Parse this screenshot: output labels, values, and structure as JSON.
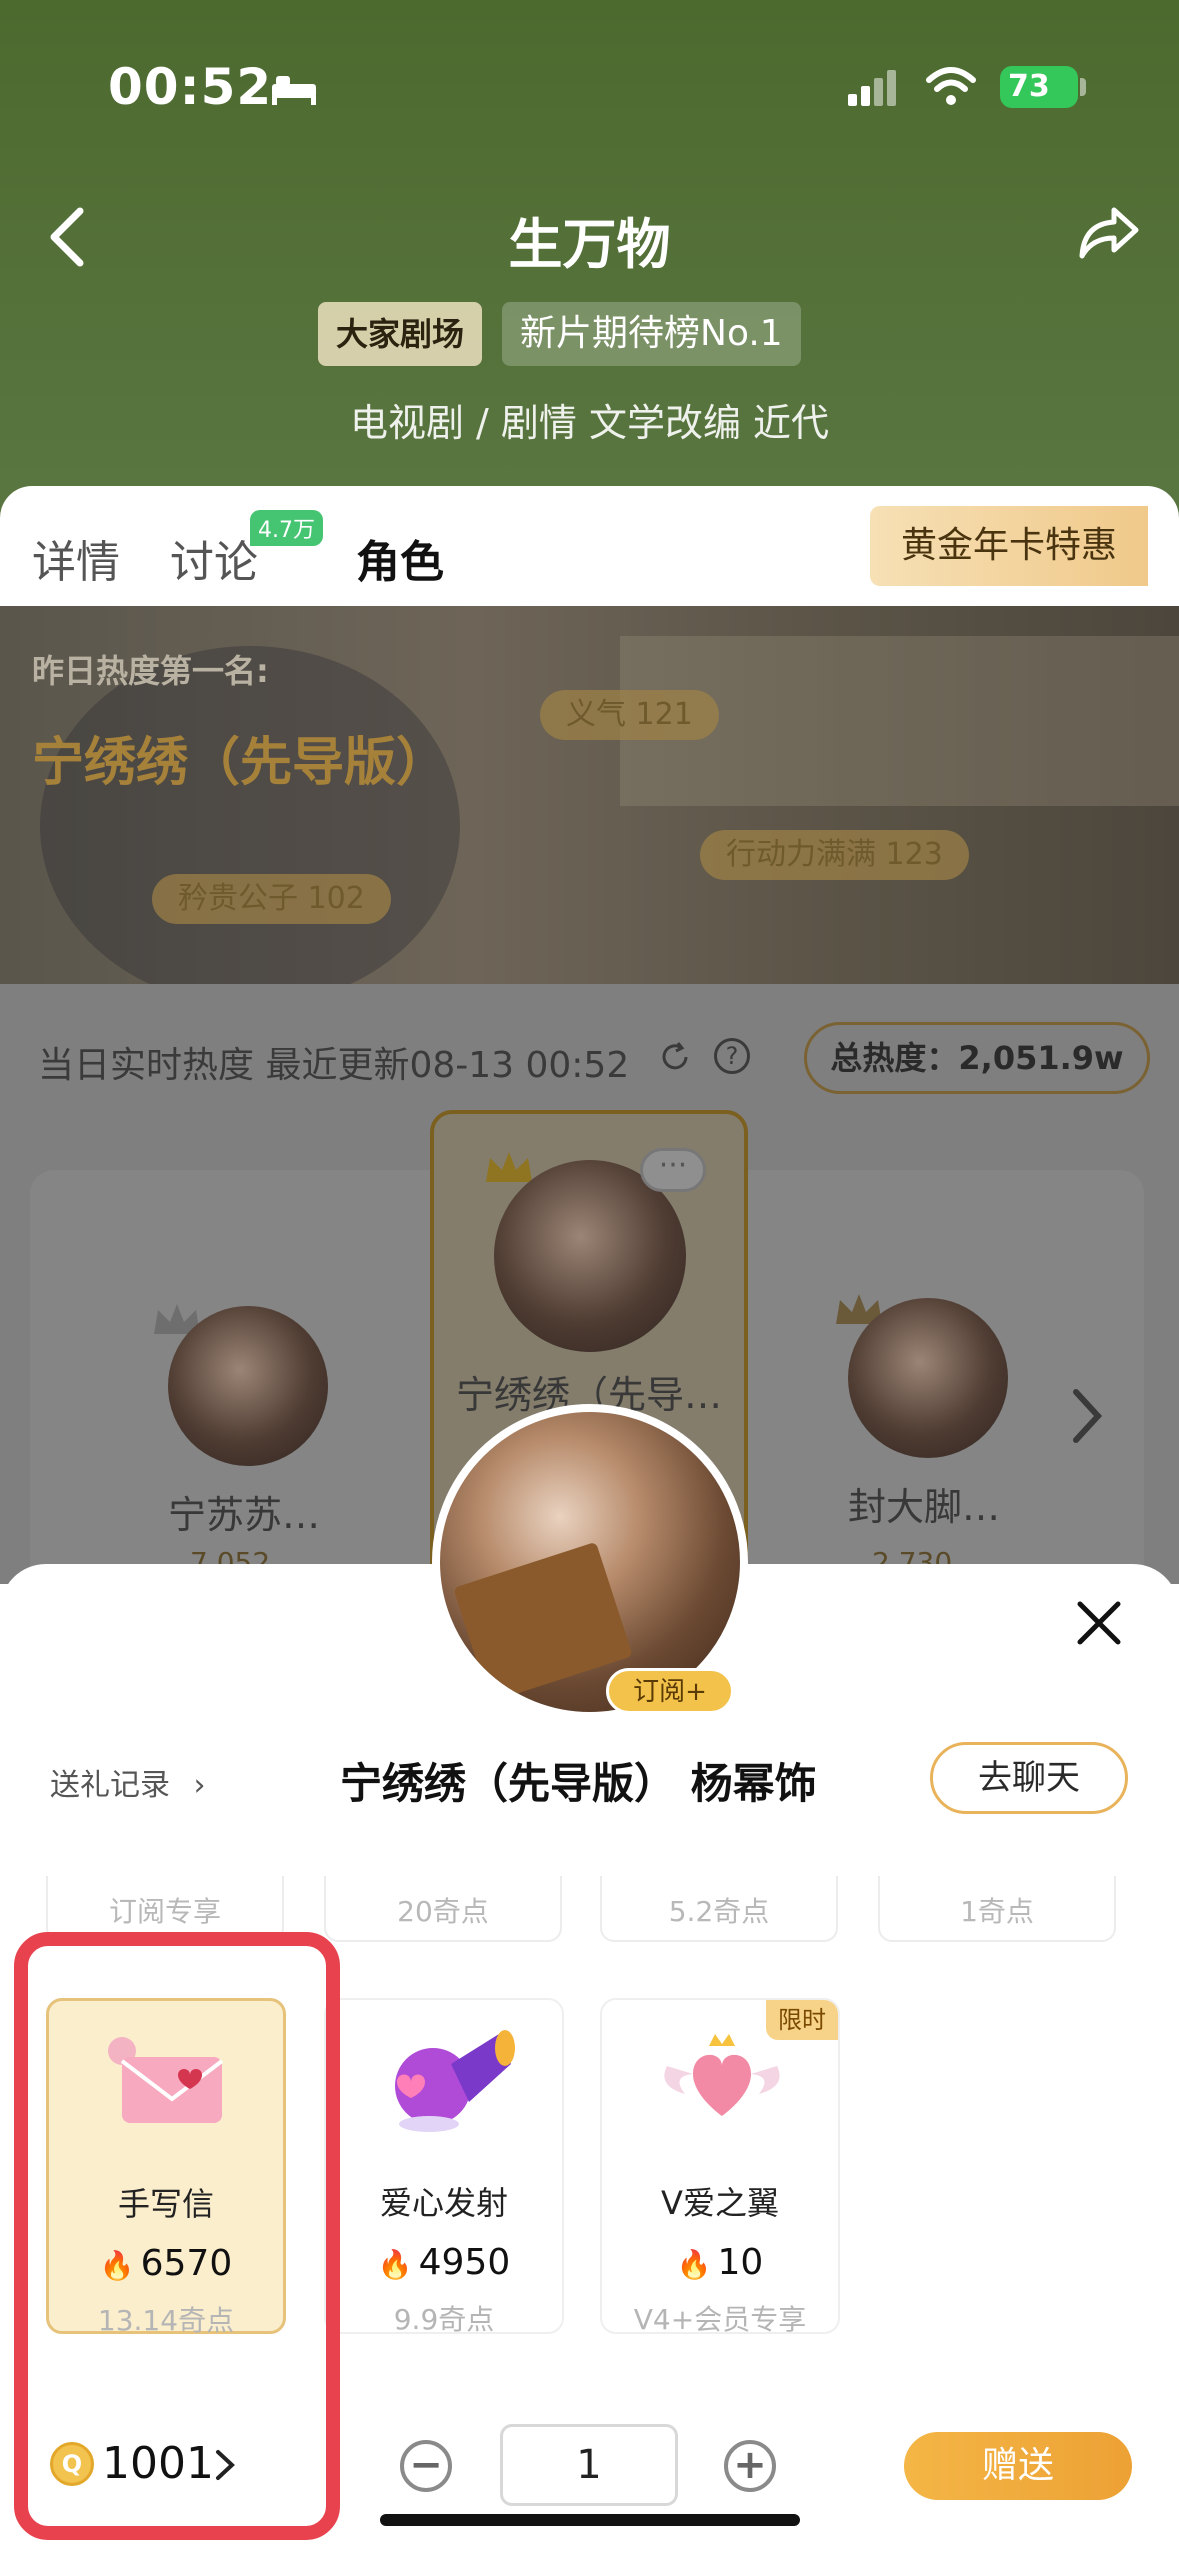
{
  "status_bar": {
    "time": "00:52",
    "battery": "73"
  },
  "header": {
    "title": "生万物",
    "badges": [
      "大家剧场",
      "新片期待榜No.1"
    ],
    "genre_line": "电视剧 / 剧情 文学改编 近代"
  },
  "tabs": {
    "items": [
      {
        "label": "详情"
      },
      {
        "label": "讨论",
        "count": "4.7万"
      },
      {
        "label": "角色"
      }
    ],
    "active": "角色",
    "promo": "黄金年卡特惠"
  },
  "banner": {
    "subtitle": "昨日热度第一名:",
    "name": "宁绣绣（先导版）",
    "tags": [
      "义气 121",
      "行动力满满 123",
      "矜贵公子 102"
    ]
  },
  "ranking": {
    "heat_line": "当日实时热度 最近更新08-13 00:52",
    "total_heat": "总热度：2,051.9w",
    "characters": [
      {
        "name": "宁苏苏…",
        "heat": "7,052"
      },
      {
        "name": "宁绣绣（先导…"
      },
      {
        "name": "封大脚…",
        "heat": "2,730"
      }
    ]
  },
  "sheet": {
    "subscribe_tag": "订阅+",
    "gift_record": "送礼记录",
    "character_title": "宁绣绣（先导版） 杨幂饰",
    "chat_button": "去聊天",
    "prev_row_prices": [
      "订阅专享",
      "20奇点",
      "5.2奇点",
      "1奇点"
    ],
    "gifts": [
      {
        "name": "手写信",
        "heat": "6570",
        "price": "13.14奇点",
        "selected": true
      },
      {
        "name": "爱心发射",
        "heat": "4950",
        "price": "9.9奇点"
      },
      {
        "name": "V爱之翼",
        "heat": "10",
        "price": "V4+会员专享",
        "badge": "限时"
      }
    ],
    "coin_icon_label": "Q",
    "coin_balance": "1001",
    "quantity": "1",
    "send_button": "赠送"
  },
  "colors": {
    "header_green": "#55713a",
    "accent_gold": "#f0a93a",
    "highlight_red": "#e8424f"
  }
}
